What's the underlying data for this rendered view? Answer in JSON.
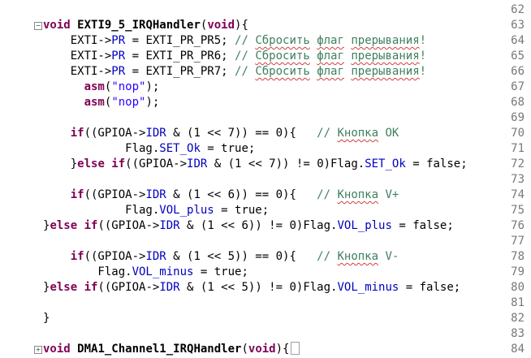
{
  "lines": [
    {
      "n": "62",
      "parts": []
    },
    {
      "n": "63",
      "fold": "minus",
      "parts": [
        [
          "kw",
          "void "
        ],
        [
          "fn",
          "EXTI9_5_IRQHandler"
        ],
        [
          "",
          "("
        ],
        [
          "kw",
          "void"
        ],
        [
          "",
          "){"
        ]
      ]
    },
    {
      "n": "64",
      "parts": [
        [
          "",
          "    EXTI->"
        ],
        [
          "fld",
          "PR"
        ],
        [
          "",
          " = EXTI_PR_PR5; "
        ],
        [
          "cm",
          "// "
        ],
        [
          "cmsq",
          "Сбросить"
        ],
        [
          "cm",
          " "
        ],
        [
          "cmsq",
          "флаг"
        ],
        [
          "cm",
          " "
        ],
        [
          "cmsq",
          "прерывания"
        ],
        [
          "cm",
          "!"
        ]
      ]
    },
    {
      "n": "65",
      "parts": [
        [
          "",
          "    EXTI->"
        ],
        [
          "fld",
          "PR"
        ],
        [
          "",
          " = EXTI_PR_PR6; "
        ],
        [
          "cm",
          "// "
        ],
        [
          "cmsq",
          "Сбросить"
        ],
        [
          "cm",
          " "
        ],
        [
          "cmsq",
          "флаг"
        ],
        [
          "cm",
          " "
        ],
        [
          "cmsq",
          "прерывания"
        ],
        [
          "cm",
          "!"
        ]
      ]
    },
    {
      "n": "66",
      "parts": [
        [
          "",
          "    EXTI->"
        ],
        [
          "fld",
          "PR"
        ],
        [
          "",
          " = EXTI_PR_PR7; "
        ],
        [
          "cm",
          "// "
        ],
        [
          "cmsq",
          "Сбросить"
        ],
        [
          "cm",
          " "
        ],
        [
          "cmsq",
          "флаг"
        ],
        [
          "cm",
          " "
        ],
        [
          "cmsq",
          "прерывания"
        ],
        [
          "cm",
          "!"
        ]
      ]
    },
    {
      "n": "67",
      "parts": [
        [
          "",
          "      "
        ],
        [
          "kw",
          "asm"
        ],
        [
          "",
          "("
        ],
        [
          "str",
          "\"nop\""
        ],
        [
          "",
          ");"
        ]
      ]
    },
    {
      "n": "68",
      "parts": [
        [
          "",
          "      "
        ],
        [
          "kw",
          "asm"
        ],
        [
          "",
          "("
        ],
        [
          "str",
          "\"nop\""
        ],
        [
          "",
          ");"
        ]
      ]
    },
    {
      "n": "69",
      "parts": []
    },
    {
      "n": "70",
      "parts": [
        [
          "",
          "    "
        ],
        [
          "kw",
          "if"
        ],
        [
          "",
          "((GPIOA->"
        ],
        [
          "fld",
          "IDR"
        ],
        [
          "",
          " & (1 << 7)) == 0){   "
        ],
        [
          "cm",
          "// "
        ],
        [
          "cmsq",
          "Кнопка"
        ],
        [
          "cm",
          " OK"
        ]
      ]
    },
    {
      "n": "71",
      "parts": [
        [
          "",
          "            Flag."
        ],
        [
          "fld",
          "SET_Ok"
        ],
        [
          "",
          " = true;"
        ]
      ]
    },
    {
      "n": "72",
      "parts": [
        [
          "",
          "    }"
        ],
        [
          "kw",
          "else if"
        ],
        [
          "",
          "((GPIOA->"
        ],
        [
          "fld",
          "IDR"
        ],
        [
          "",
          " & (1 << 7)) != 0)Flag."
        ],
        [
          "fld",
          "SET_Ok"
        ],
        [
          "",
          " = false;"
        ]
      ]
    },
    {
      "n": "73",
      "parts": []
    },
    {
      "n": "74",
      "parts": [
        [
          "",
          "    "
        ],
        [
          "kw",
          "if"
        ],
        [
          "",
          "((GPIOA->"
        ],
        [
          "fld",
          "IDR"
        ],
        [
          "",
          " & (1 << 6)) == 0){   "
        ],
        [
          "cm",
          "// "
        ],
        [
          "cmsq",
          "Кнопка"
        ],
        [
          "cm",
          " V+"
        ]
      ]
    },
    {
      "n": "75",
      "parts": [
        [
          "",
          "            Flag."
        ],
        [
          "fld",
          "VOL_plus"
        ],
        [
          "",
          " = true;"
        ]
      ]
    },
    {
      "n": "76",
      "parts": [
        [
          "",
          "}"
        ],
        [
          "kw",
          "else if"
        ],
        [
          "",
          "((GPIOA->"
        ],
        [
          "fld",
          "IDR"
        ],
        [
          "",
          " & (1 << 6)) != 0)Flag."
        ],
        [
          "fld",
          "VOL_plus"
        ],
        [
          "",
          " = false;"
        ]
      ]
    },
    {
      "n": "77",
      "parts": []
    },
    {
      "n": "78",
      "parts": [
        [
          "",
          "    "
        ],
        [
          "kw",
          "if"
        ],
        [
          "",
          "((GPIOA->"
        ],
        [
          "fld",
          "IDR"
        ],
        [
          "",
          " & (1 << 5)) == 0){   "
        ],
        [
          "cm",
          "// "
        ],
        [
          "cmsq",
          "Кнопка"
        ],
        [
          "cm",
          " V-"
        ]
      ]
    },
    {
      "n": "79",
      "parts": [
        [
          "",
          "        Flag."
        ],
        [
          "fld",
          "VOL_minus"
        ],
        [
          "",
          " = true;"
        ]
      ]
    },
    {
      "n": "80",
      "parts": [
        [
          "",
          "}"
        ],
        [
          "kw",
          "else if"
        ],
        [
          "",
          "((GPIOA->"
        ],
        [
          "fld",
          "IDR"
        ],
        [
          "",
          " & (1 << 5)) != 0)Flag."
        ],
        [
          "fld",
          "VOL_minus"
        ],
        [
          "",
          " = false;"
        ]
      ]
    },
    {
      "n": "81",
      "parts": []
    },
    {
      "n": "82",
      "parts": [
        [
          "",
          "}"
        ]
      ]
    },
    {
      "n": "83",
      "parts": []
    },
    {
      "n": "84",
      "fold": "plus",
      "collapsed": true,
      "parts": [
        [
          "kw",
          "void "
        ],
        [
          "fn",
          "DMA1_Channel1_IRQHandler"
        ],
        [
          "",
          "("
        ],
        [
          "kw",
          "void"
        ],
        [
          "",
          "){"
        ]
      ]
    }
  ],
  "fold_glyphs": {
    "minus": "−",
    "plus": "+"
  }
}
